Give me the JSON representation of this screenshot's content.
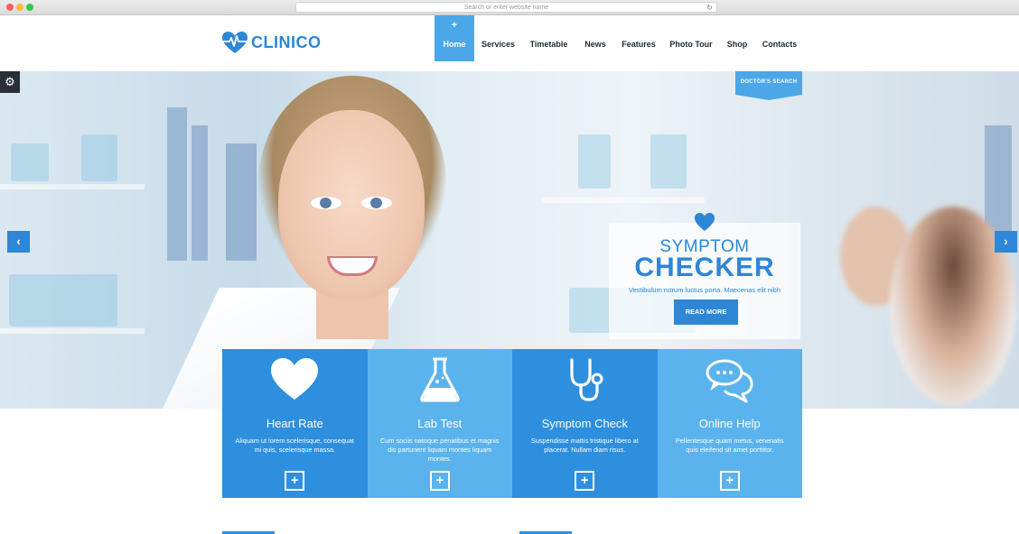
{
  "browser": {
    "url_placeholder": "Search or enter website name",
    "reload_icon": "reload-icon"
  },
  "brand": {
    "name": "CLINICO",
    "color": "#2d87d6"
  },
  "nav": {
    "items": [
      {
        "label": "Home",
        "active": true
      },
      {
        "label": "Services"
      },
      {
        "label": "Timetable"
      },
      {
        "label": "News"
      },
      {
        "label": "Features"
      },
      {
        "label": "Photo Tour"
      },
      {
        "label": "Shop"
      },
      {
        "label": "Contacts"
      }
    ],
    "plus": "+"
  },
  "doctor_search": {
    "label": "DOCTOR'S SEARCH"
  },
  "promo": {
    "title_line1": "SYMPTOM",
    "title_line2": "CHECKER",
    "subtitle": "Vestibulum rutrum luctus porta. Maecenas elit nibh",
    "button": "READ MORE"
  },
  "slider": {
    "prev": "‹",
    "next": "›"
  },
  "settings": {
    "icon": "gears-icon",
    "glyph": "⚙"
  },
  "cards": [
    {
      "title": "Heart Rate",
      "text": "Aliquam ut lorem scelerisque, consequat mi quis, scelerisque massa.",
      "color": "#2d8fde",
      "icon": "heart-icon"
    },
    {
      "title": "Lab Test",
      "text": "Cum sociis natoque penatibus et magnis dis parturient liquam montes liquam montes.",
      "color": "#5ab3ec",
      "icon": "flask-icon"
    },
    {
      "title": "Symptom Check",
      "text": "Suspendisse mattis tristique libero at placerat. Nullam diam risus.",
      "color": "#2d8fde",
      "icon": "stethoscope-icon"
    },
    {
      "title": "Online Help",
      "text": "Pellentesque quam metus, venenatis quis eleifend sit amet porttitor.",
      "color": "#5ab3ec",
      "icon": "chat-bubbles-icon"
    }
  ],
  "card_plus": "+"
}
